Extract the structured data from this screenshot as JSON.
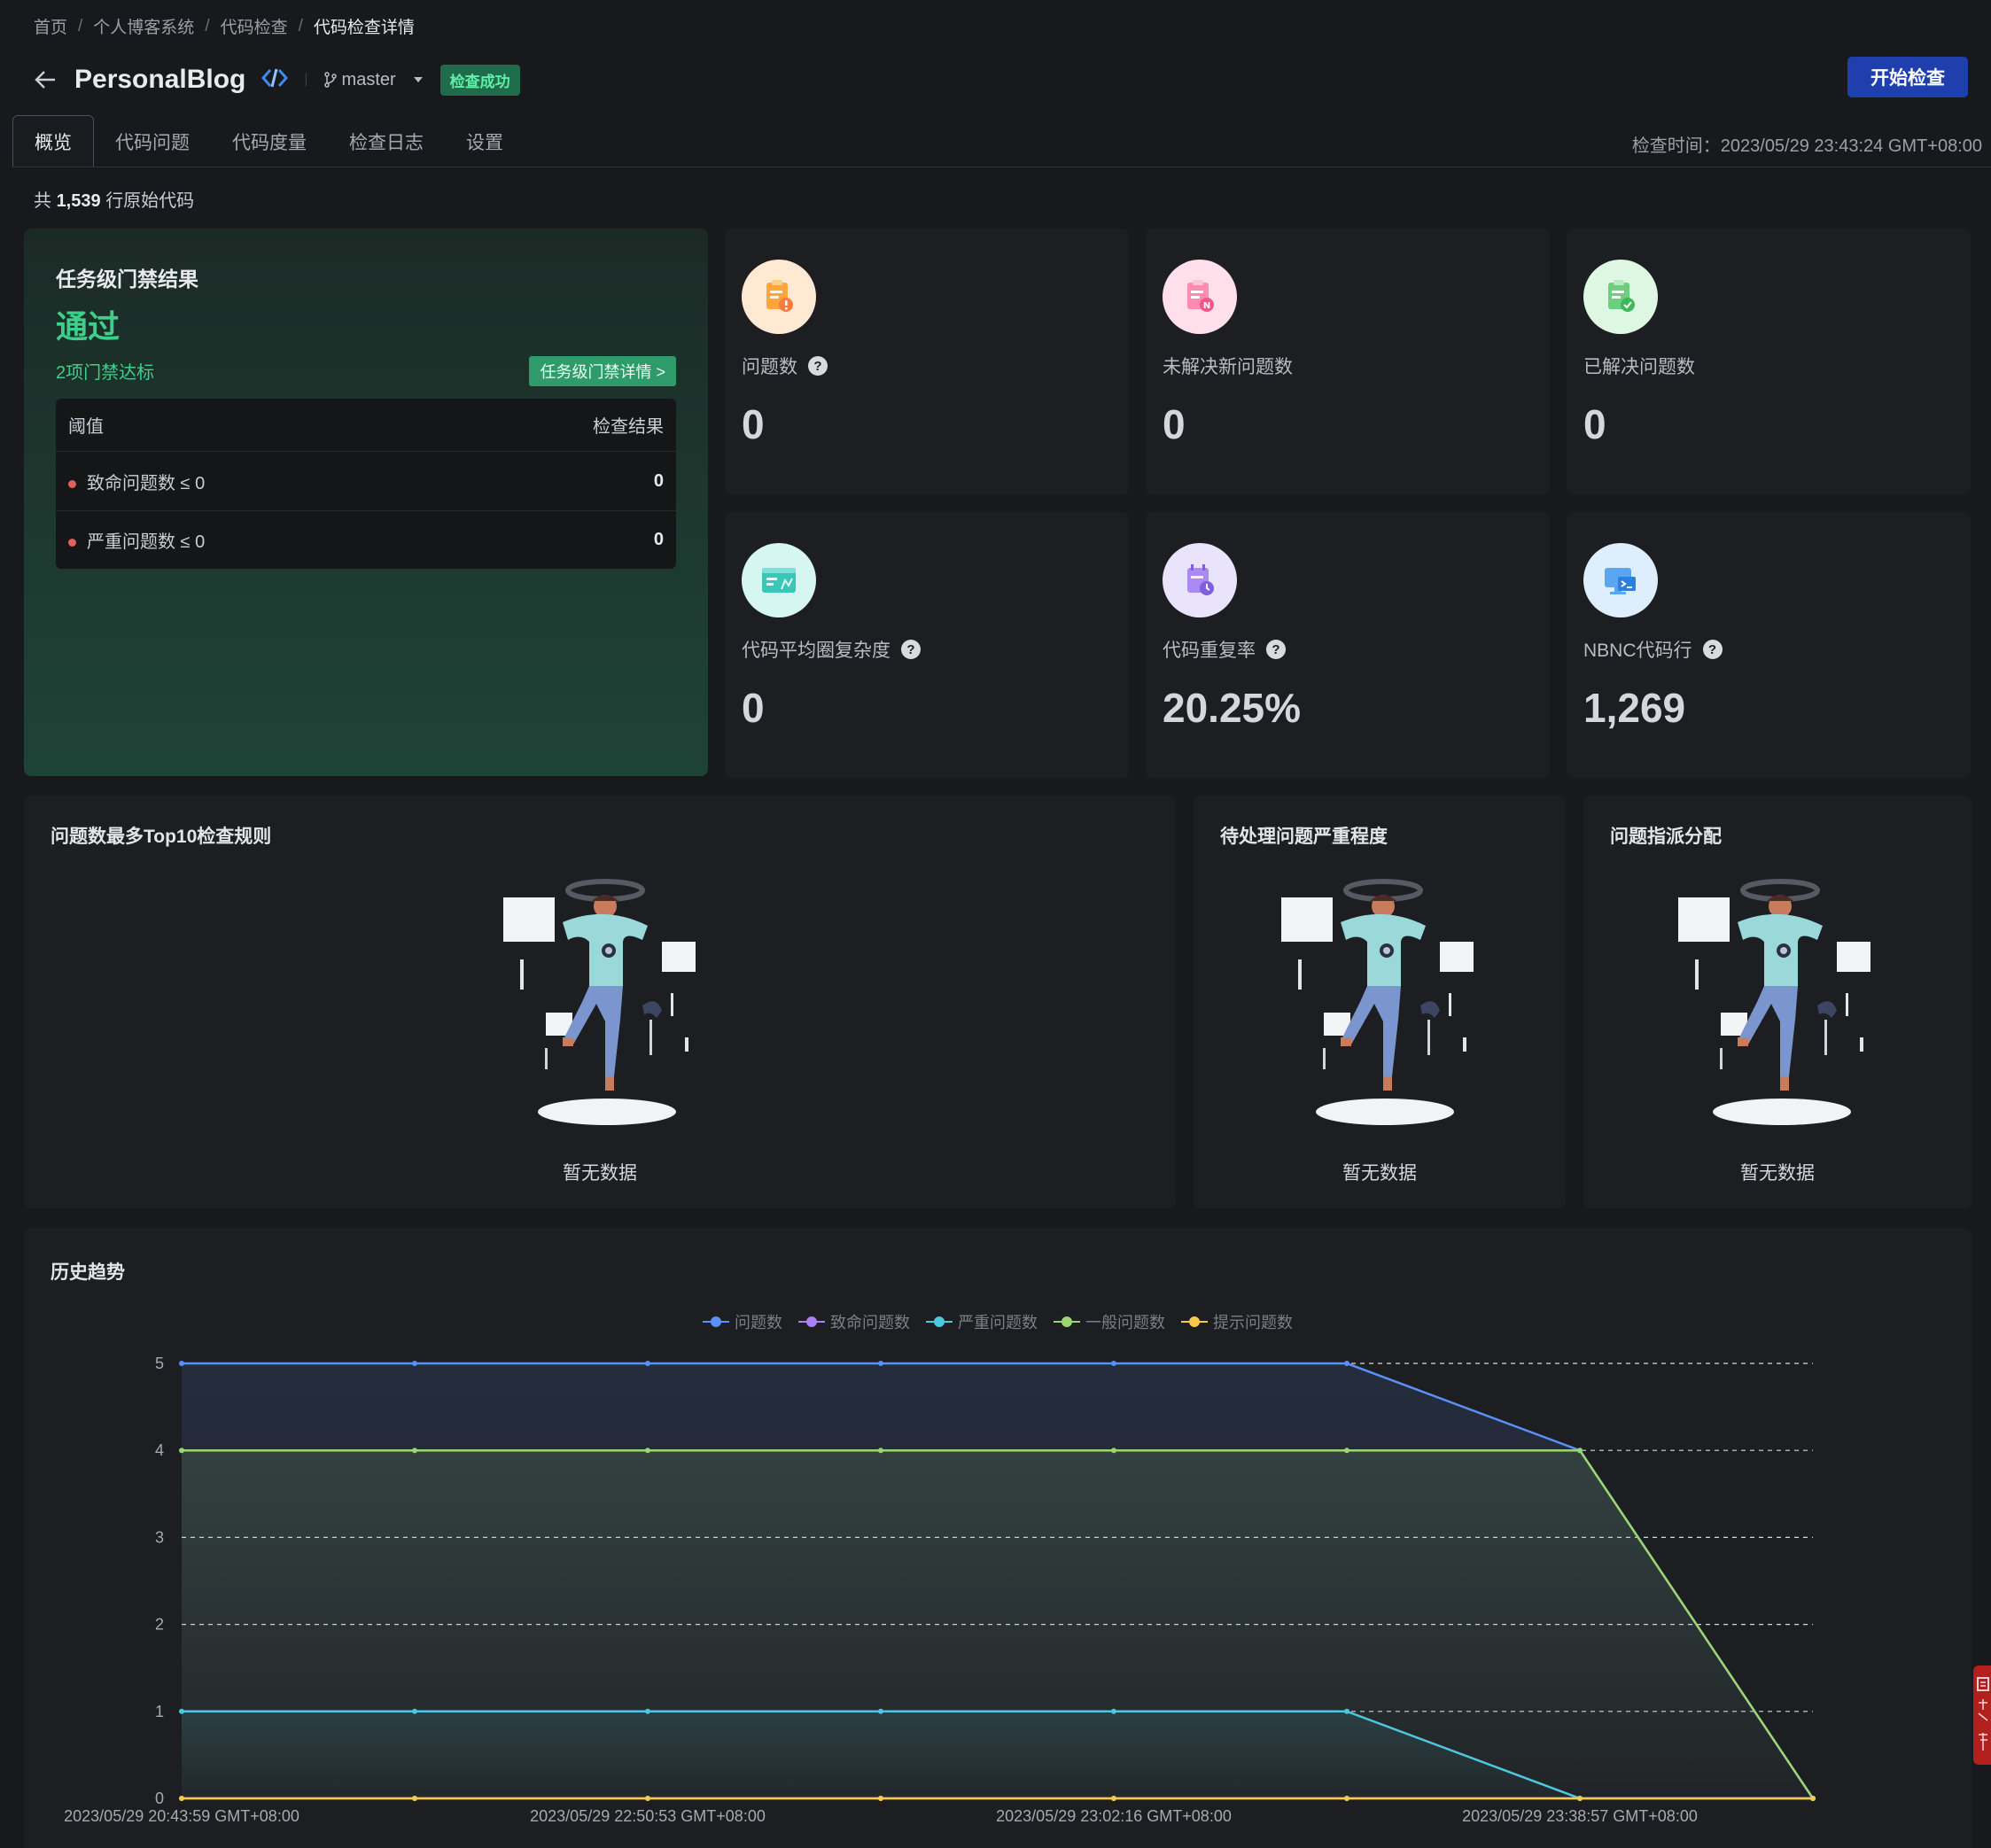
{
  "breadcrumb": [
    "首页",
    "个人博客系统",
    "代码检查",
    "代码检查详情"
  ],
  "header": {
    "repo_name": "PersonalBlog",
    "branch": "master",
    "status_badge": "检查成功",
    "start_button": "开始检查"
  },
  "tabs": [
    "概览",
    "代码问题",
    "代码度量",
    "检查日志",
    "设置"
  ],
  "check_time": "检查时间：2023/05/29 23:43:24 GMT+08:00",
  "lines_of_code": {
    "prefix": "共",
    "value": "1,539",
    "suffix": "行原始代码"
  },
  "gate": {
    "title": "任务级门禁结果",
    "result": "通过",
    "summary": "2项门禁达标",
    "detail_button": "任务级门禁详情  >",
    "col_threshold": "阈值",
    "col_result": "检查结果",
    "rows": [
      {
        "label": "致命问题数 ≤ 0",
        "value": "0"
      },
      {
        "label": "严重问题数 ≤ 0",
        "value": "0"
      }
    ]
  },
  "metrics": [
    {
      "label": "问题数",
      "value": "0",
      "icon": "issue-clipboard-icon",
      "has_help": true,
      "icon_bg": "#ffe6cc"
    },
    {
      "label": "未解决新问题数",
      "value": "0",
      "icon": "new-issue-clipboard-icon",
      "has_help": false,
      "icon_bg": "#ffdde8"
    },
    {
      "label": "已解决问题数",
      "value": "0",
      "icon": "resolved-clipboard-icon",
      "has_help": false,
      "icon_bg": "#dff7e4"
    },
    {
      "label": "代码平均圈复杂度",
      "value": "0",
      "icon": "complexity-window-icon",
      "has_help": true,
      "icon_bg": "#d6f6f2"
    },
    {
      "label": "代码重复率",
      "value": "20.25%",
      "icon": "duplication-calendar-icon",
      "has_help": true,
      "icon_bg": "#e8e2fb"
    },
    {
      "label": "NBNC代码行",
      "value": "1,269",
      "icon": "code-terminal-icon",
      "has_help": true,
      "icon_bg": "#deeefd"
    }
  ],
  "panels": {
    "top10": {
      "title": "问题数最多Top10检查规则",
      "empty": "暂无数据"
    },
    "severity": {
      "title": "待处理问题严重程度",
      "empty": "暂无数据"
    },
    "assign": {
      "title": "问题指派分配",
      "empty": "暂无数据"
    }
  },
  "trend_title": "历史趋势",
  "colors": {
    "accent": "#1f3fae",
    "success": "#3ed08a"
  },
  "chart_data": {
    "type": "area",
    "title": "历史趋势",
    "x": [
      "2023/05/29 20:43:59 GMT+08:00",
      "",
      "2023/05/29 22:50:53 GMT+08:00",
      "",
      "2023/05/29 23:02:16 GMT+08:00",
      "",
      "2023/05/29 23:38:57 GMT+08:00",
      ""
    ],
    "x_tick_labels": [
      "2023/05/29 20:43:59 GMT+08:00",
      "2023/05/29 22:50:53 GMT+08:00",
      "2023/05/29 23:02:16 GMT+08:00",
      "2023/05/29 23:38:57 GMT+08:00"
    ],
    "ylim": [
      0,
      5
    ],
    "yticks": [
      "0",
      "1",
      "2",
      "3",
      "4",
      "5"
    ],
    "grid": true,
    "legend_position": "top-center",
    "series": [
      {
        "name": "问题数",
        "color": "#5b8ff9",
        "values": [
          5,
          5,
          5,
          5,
          5,
          5,
          4,
          0
        ]
      },
      {
        "name": "致命问题数",
        "color": "#a97ff5",
        "values": [
          0,
          0,
          0,
          0,
          0,
          0,
          0,
          0
        ]
      },
      {
        "name": "严重问题数",
        "color": "#4ec7e0",
        "values": [
          1,
          1,
          1,
          1,
          1,
          1,
          0,
          0
        ]
      },
      {
        "name": "一般问题数",
        "color": "#9bd672",
        "values": [
          4,
          4,
          4,
          4,
          4,
          4,
          4,
          0
        ]
      },
      {
        "name": "提示问题数",
        "color": "#f5c94a",
        "values": [
          0,
          0,
          0,
          0,
          0,
          0,
          0,
          0
        ]
      }
    ]
  }
}
